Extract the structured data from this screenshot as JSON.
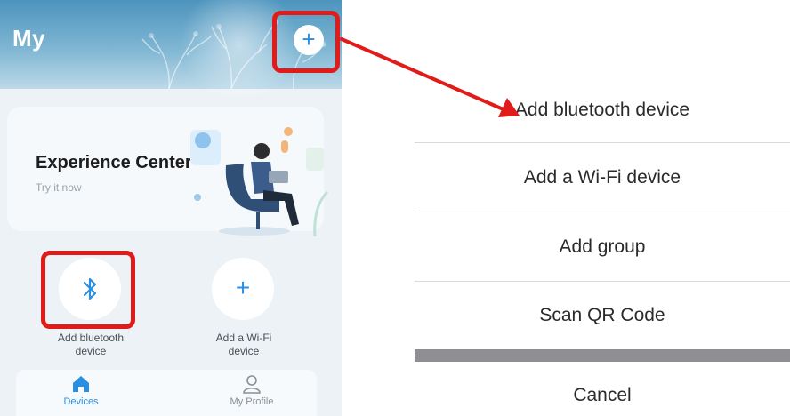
{
  "header": {
    "title": "My",
    "add_button_glyph": "+"
  },
  "experience_card": {
    "title": "Experience Center",
    "subtitle": "Try it now"
  },
  "quick_actions": [
    {
      "icon": "bluetooth-icon",
      "label_line1": "Add bluetooth",
      "label_line2": "device"
    },
    {
      "icon": "plus-icon",
      "glyph": "+",
      "label_line1": "Add a Wi-Fi",
      "label_line2": "device"
    }
  ],
  "tabbar": {
    "items": [
      {
        "icon": "home-icon",
        "label": "Devices",
        "active": true
      },
      {
        "icon": "profile-icon",
        "label": "My Profile",
        "active": false
      }
    ]
  },
  "action_sheet": {
    "items": [
      {
        "label": "Add bluetooth device"
      },
      {
        "label": "Add a Wi-Fi device"
      },
      {
        "label": "Add group"
      },
      {
        "label": "Scan QR Code"
      }
    ],
    "cancel_label": "Cancel"
  },
  "colors": {
    "accent": "#2a8fe0",
    "highlight": "#e11a1a",
    "active_tab": "#2a8fe0",
    "inactive_tab": "#8a9098"
  }
}
